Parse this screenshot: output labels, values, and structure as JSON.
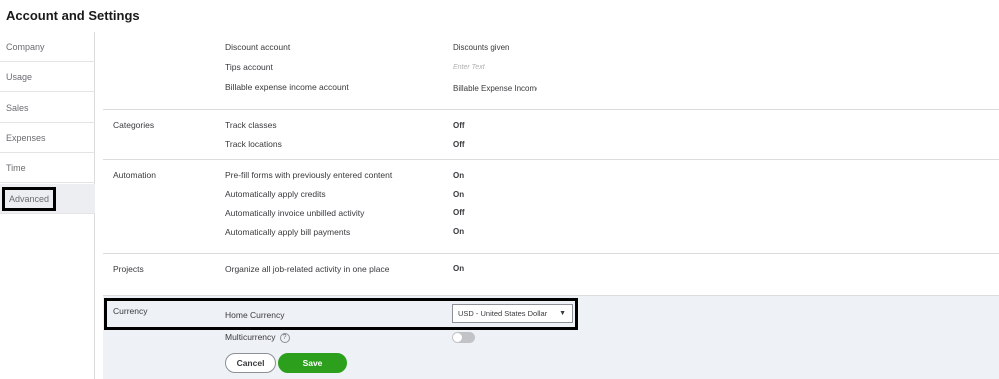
{
  "page": {
    "title": "Account and Settings"
  },
  "sidebar": {
    "items": [
      {
        "label": "Company"
      },
      {
        "label": "Usage"
      },
      {
        "label": "Sales"
      },
      {
        "label": "Expenses"
      },
      {
        "label": "Time"
      },
      {
        "label": "Advanced",
        "active": true
      }
    ]
  },
  "accounts": {
    "discount_label": "Discount account",
    "discount_value": "Discounts given",
    "tips_label": "Tips account",
    "tips_placeholder": "Enter Text",
    "billable_label": "Billable expense income account",
    "billable_value": "Billable Expense Income"
  },
  "categories": {
    "title": "Categories",
    "track_classes_label": "Track classes",
    "track_classes_value": "Off",
    "track_locations_label": "Track locations",
    "track_locations_value": "Off"
  },
  "automation": {
    "title": "Automation",
    "prefill_label": "Pre-fill forms with previously entered content",
    "prefill_value": "On",
    "credits_label": "Automatically apply credits",
    "credits_value": "On",
    "invoice_label": "Automatically invoice unbilled activity",
    "invoice_value": "Off",
    "bill_payments_label": "Automatically apply bill payments",
    "bill_payments_value": "On"
  },
  "projects": {
    "title": "Projects",
    "organize_label": "Organize all job-related activity in one place",
    "organize_value": "On"
  },
  "currency": {
    "title": "Currency",
    "home_label": "Home Currency",
    "home_value": "USD - United States Dollar",
    "multicurrency_label": "Multicurrency",
    "multicurrency_enabled": false,
    "cancel_label": "Cancel",
    "save_label": "Save"
  },
  "colors": {
    "save_button": "#2ca01c",
    "active_sidebar": "#eceef1",
    "currency_bg": "#eef1f6"
  },
  "icons": {
    "help": "help-circle-icon",
    "dropdown": "caret-down-icon"
  }
}
